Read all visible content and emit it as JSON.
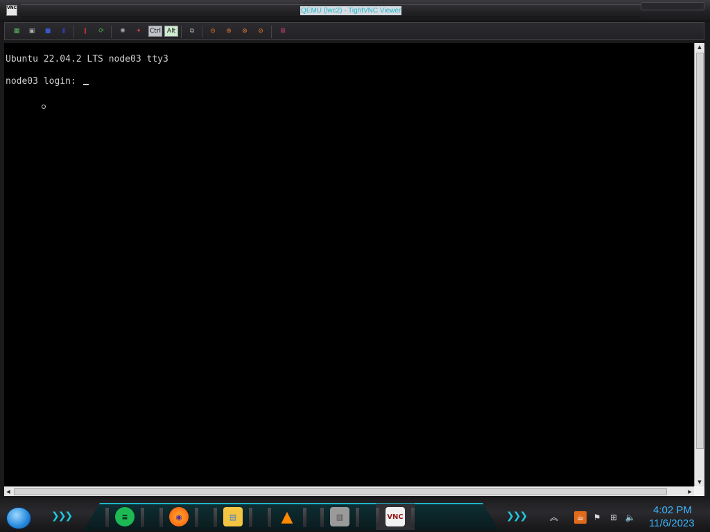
{
  "window": {
    "title": "QEMU (lwc2) - TightVNC Viewer",
    "icon_label": "VNC"
  },
  "toolbar": {
    "buttons": [
      {
        "name": "connection-options-icon",
        "glyph": "▦",
        "color": "#5cb85c"
      },
      {
        "name": "save-icon",
        "glyph": "▣",
        "color": "#b0b0b0"
      },
      {
        "name": "new-connection-icon",
        "glyph": "■",
        "color": "#3b58c8"
      },
      {
        "name": "connection-info-icon",
        "glyph": "▮",
        "color": "#2d3aa0"
      },
      {
        "name": "pause-icon",
        "glyph": "‖",
        "color": "#e03b3b"
      },
      {
        "name": "refresh-icon",
        "glyph": "⟳",
        "color": "#4aa84a"
      },
      {
        "name": "send-ctrl-alt-del-icon",
        "glyph": "✺",
        "color": "#aaaaaa"
      },
      {
        "name": "send-ctrl-esc-icon",
        "glyph": "✦",
        "color": "#cc4444"
      },
      {
        "name": "transfer-files-icon",
        "glyph": "⧉",
        "color": "#b0b0b0"
      },
      {
        "name": "zoom-out-icon",
        "glyph": "⊖",
        "color": "#e0762b"
      },
      {
        "name": "zoom-in-icon",
        "glyph": "⊕",
        "color": "#e0762b"
      },
      {
        "name": "zoom-100-icon",
        "glyph": "⊗",
        "color": "#e0762b"
      },
      {
        "name": "zoom-fit-icon",
        "glyph": "⊘",
        "color": "#e0762b"
      },
      {
        "name": "fullscreen-icon",
        "glyph": "⊠",
        "color": "#d23a6a"
      }
    ],
    "ctrl_label": "Ctrl",
    "alt_label": "Alt"
  },
  "console": {
    "line1": "Ubuntu 22.04.2 LTS node03 tty3",
    "line2": "node03 login: "
  },
  "taskbar": {
    "apps": [
      {
        "name": "spotify-icon",
        "bg": "#1db954",
        "fg": "#0b0b0b",
        "glyph": "≡"
      },
      {
        "name": "firefox-icon",
        "bg": "#ff6a00",
        "fg": "#5a2a9a",
        "glyph": "◉"
      },
      {
        "name": "file-explorer-icon",
        "bg": "#f4c542",
        "fg": "#3a7bd5",
        "glyph": "▤"
      },
      {
        "name": "vlc-icon",
        "bg": "#ff8800",
        "fg": "#ffffff",
        "glyph": "▲"
      },
      {
        "name": "firewall-icon",
        "bg": "#9a9a9a",
        "fg": "#4a4a4a",
        "glyph": "▥"
      },
      {
        "name": "tightvnc-taskbar-icon",
        "bg": "#f2f2f2",
        "fg": "#9a1a1a",
        "glyph": "VNC"
      }
    ],
    "tray": {
      "show_hidden_glyph": "︽",
      "java_glyph": "☕",
      "flag_glyph": "⚑",
      "network_glyph": "⊞",
      "volume_glyph": "🔈"
    },
    "clock": {
      "time": "4:02 PM",
      "date": "11/6/2023"
    }
  }
}
